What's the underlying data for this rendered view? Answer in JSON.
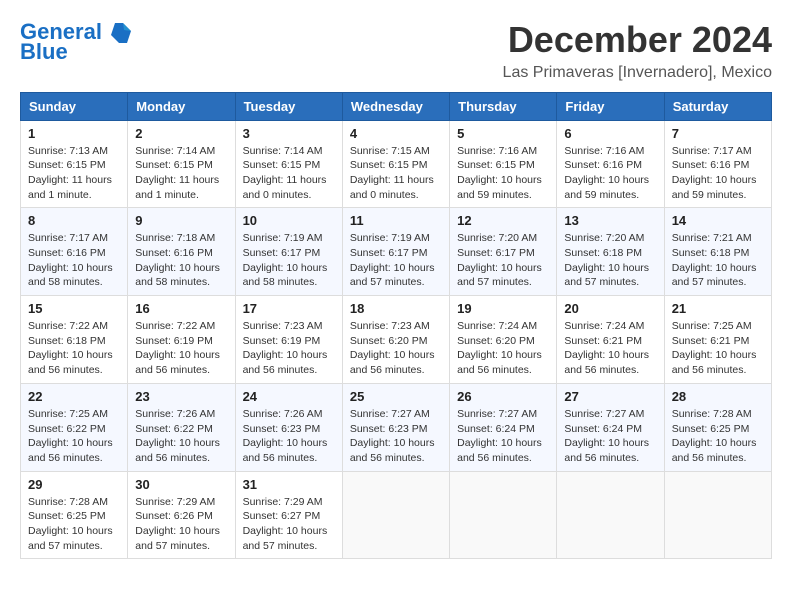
{
  "header": {
    "logo_line1": "General",
    "logo_line2": "Blue",
    "title": "December 2024",
    "subtitle": "Las Primaveras [Invernadero], Mexico"
  },
  "calendar": {
    "days_of_week": [
      "Sunday",
      "Monday",
      "Tuesday",
      "Wednesday",
      "Thursday",
      "Friday",
      "Saturday"
    ],
    "weeks": [
      [
        {
          "day": "",
          "empty": true
        },
        {
          "day": "",
          "empty": true
        },
        {
          "day": "",
          "empty": true
        },
        {
          "day": "",
          "empty": true
        },
        {
          "day": "",
          "empty": true
        },
        {
          "day": "",
          "empty": true
        },
        {
          "day": "",
          "empty": true
        }
      ],
      [
        {
          "day": "1",
          "sunrise": "7:13 AM",
          "sunset": "6:15 PM",
          "daylight": "11 hours and 1 minute."
        },
        {
          "day": "2",
          "sunrise": "7:14 AM",
          "sunset": "6:15 PM",
          "daylight": "11 hours and 1 minute."
        },
        {
          "day": "3",
          "sunrise": "7:14 AM",
          "sunset": "6:15 PM",
          "daylight": "11 hours and 0 minutes."
        },
        {
          "day": "4",
          "sunrise": "7:15 AM",
          "sunset": "6:15 PM",
          "daylight": "11 hours and 0 minutes."
        },
        {
          "day": "5",
          "sunrise": "7:16 AM",
          "sunset": "6:15 PM",
          "daylight": "10 hours and 59 minutes."
        },
        {
          "day": "6",
          "sunrise": "7:16 AM",
          "sunset": "6:16 PM",
          "daylight": "10 hours and 59 minutes."
        },
        {
          "day": "7",
          "sunrise": "7:17 AM",
          "sunset": "6:16 PM",
          "daylight": "10 hours and 59 minutes."
        }
      ],
      [
        {
          "day": "8",
          "sunrise": "7:17 AM",
          "sunset": "6:16 PM",
          "daylight": "10 hours and 58 minutes."
        },
        {
          "day": "9",
          "sunrise": "7:18 AM",
          "sunset": "6:16 PM",
          "daylight": "10 hours and 58 minutes."
        },
        {
          "day": "10",
          "sunrise": "7:19 AM",
          "sunset": "6:17 PM",
          "daylight": "10 hours and 58 minutes."
        },
        {
          "day": "11",
          "sunrise": "7:19 AM",
          "sunset": "6:17 PM",
          "daylight": "10 hours and 57 minutes."
        },
        {
          "day": "12",
          "sunrise": "7:20 AM",
          "sunset": "6:17 PM",
          "daylight": "10 hours and 57 minutes."
        },
        {
          "day": "13",
          "sunrise": "7:20 AM",
          "sunset": "6:18 PM",
          "daylight": "10 hours and 57 minutes."
        },
        {
          "day": "14",
          "sunrise": "7:21 AM",
          "sunset": "6:18 PM",
          "daylight": "10 hours and 57 minutes."
        }
      ],
      [
        {
          "day": "15",
          "sunrise": "7:22 AM",
          "sunset": "6:18 PM",
          "daylight": "10 hours and 56 minutes."
        },
        {
          "day": "16",
          "sunrise": "7:22 AM",
          "sunset": "6:19 PM",
          "daylight": "10 hours and 56 minutes."
        },
        {
          "day": "17",
          "sunrise": "7:23 AM",
          "sunset": "6:19 PM",
          "daylight": "10 hours and 56 minutes."
        },
        {
          "day": "18",
          "sunrise": "7:23 AM",
          "sunset": "6:20 PM",
          "daylight": "10 hours and 56 minutes."
        },
        {
          "day": "19",
          "sunrise": "7:24 AM",
          "sunset": "6:20 PM",
          "daylight": "10 hours and 56 minutes."
        },
        {
          "day": "20",
          "sunrise": "7:24 AM",
          "sunset": "6:21 PM",
          "daylight": "10 hours and 56 minutes."
        },
        {
          "day": "21",
          "sunrise": "7:25 AM",
          "sunset": "6:21 PM",
          "daylight": "10 hours and 56 minutes."
        }
      ],
      [
        {
          "day": "22",
          "sunrise": "7:25 AM",
          "sunset": "6:22 PM",
          "daylight": "10 hours and 56 minutes."
        },
        {
          "day": "23",
          "sunrise": "7:26 AM",
          "sunset": "6:22 PM",
          "daylight": "10 hours and 56 minutes."
        },
        {
          "day": "24",
          "sunrise": "7:26 AM",
          "sunset": "6:23 PM",
          "daylight": "10 hours and 56 minutes."
        },
        {
          "day": "25",
          "sunrise": "7:27 AM",
          "sunset": "6:23 PM",
          "daylight": "10 hours and 56 minutes."
        },
        {
          "day": "26",
          "sunrise": "7:27 AM",
          "sunset": "6:24 PM",
          "daylight": "10 hours and 56 minutes."
        },
        {
          "day": "27",
          "sunrise": "7:27 AM",
          "sunset": "6:24 PM",
          "daylight": "10 hours and 56 minutes."
        },
        {
          "day": "28",
          "sunrise": "7:28 AM",
          "sunset": "6:25 PM",
          "daylight": "10 hours and 56 minutes."
        }
      ],
      [
        {
          "day": "29",
          "sunrise": "7:28 AM",
          "sunset": "6:25 PM",
          "daylight": "10 hours and 57 minutes."
        },
        {
          "day": "30",
          "sunrise": "7:29 AM",
          "sunset": "6:26 PM",
          "daylight": "10 hours and 57 minutes."
        },
        {
          "day": "31",
          "sunrise": "7:29 AM",
          "sunset": "6:27 PM",
          "daylight": "10 hours and 57 minutes."
        },
        {
          "day": "",
          "empty": true
        },
        {
          "day": "",
          "empty": true
        },
        {
          "day": "",
          "empty": true
        },
        {
          "day": "",
          "empty": true
        }
      ]
    ]
  }
}
